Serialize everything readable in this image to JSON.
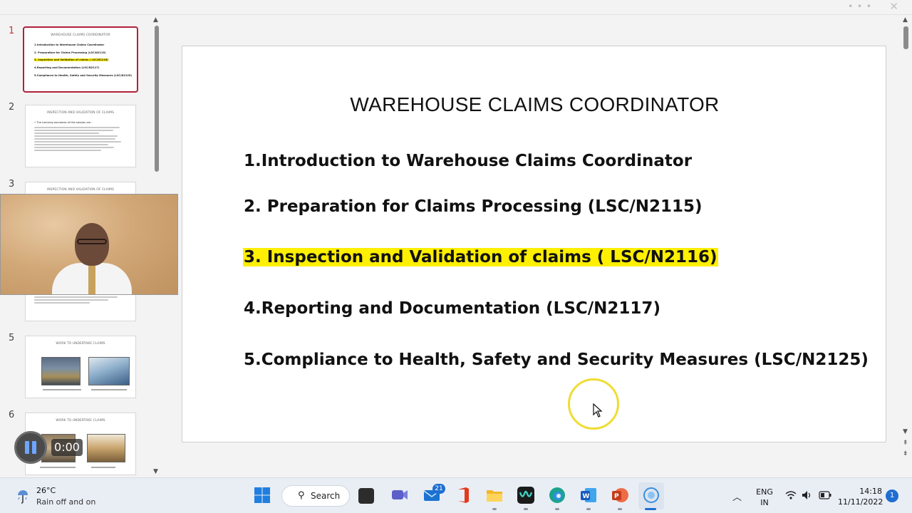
{
  "window": {
    "more_icon": "more-dots-icon",
    "close_icon": "close-icon"
  },
  "thumbnails": {
    "numbers": [
      "1",
      "2",
      "3",
      "5",
      "6"
    ],
    "slide1": {
      "title": "WAREHOUSE CLAIMS COORDINATOR",
      "items": [
        "1.Introduction to Warehouse Claims Coordinator",
        "2. Preparation for Claims Processing (LSC/N2115)",
        "3. Inspection and Validation of claims ( LSC/N2116)",
        "4.Reporting and Documentation (LSC/N2117)",
        "5.Compliance to Health, Safety and Security Measures (LSC/N2125)"
      ]
    },
    "slide2": {
      "title": "INSPECTION AND VALIDATION OF CLAIMS",
      "subtitle": "• The Learning outcomes of this session are :"
    },
    "slide3": {
      "title": "INSPECTION AND VALIDATION OF CLAIMS"
    },
    "slide5": {
      "title": "WORK TO UNDERTAKE CLAIMS"
    },
    "slide6": {
      "title": "WORK TO UNDERTAKE CLAIMS"
    }
  },
  "media": {
    "time": "0:00",
    "state": "paused"
  },
  "slide": {
    "title": "WAREHOUSE CLAIMS COORDINATOR",
    "items": [
      "1.Introduction to Warehouse Claims Coordinator",
      "2. Preparation for Claims Processing (LSC/N2115)",
      "3. Inspection and Validation of claims ( LSC/N2116)",
      "4.Reporting and Documentation (LSC/N2117)",
      "5.Compliance to Health, Safety and Security Measures (LSC/N2125)"
    ],
    "highlight_color": "#ffef00"
  },
  "taskbar": {
    "weather_temp": "26°C",
    "weather_desc": "Rain off and on",
    "search_label": "Search",
    "mail_badge": "21",
    "lang_line1": "ENG",
    "lang_line2": "IN",
    "time": "14:18",
    "date": "11/11/2022",
    "notifications": "1"
  }
}
